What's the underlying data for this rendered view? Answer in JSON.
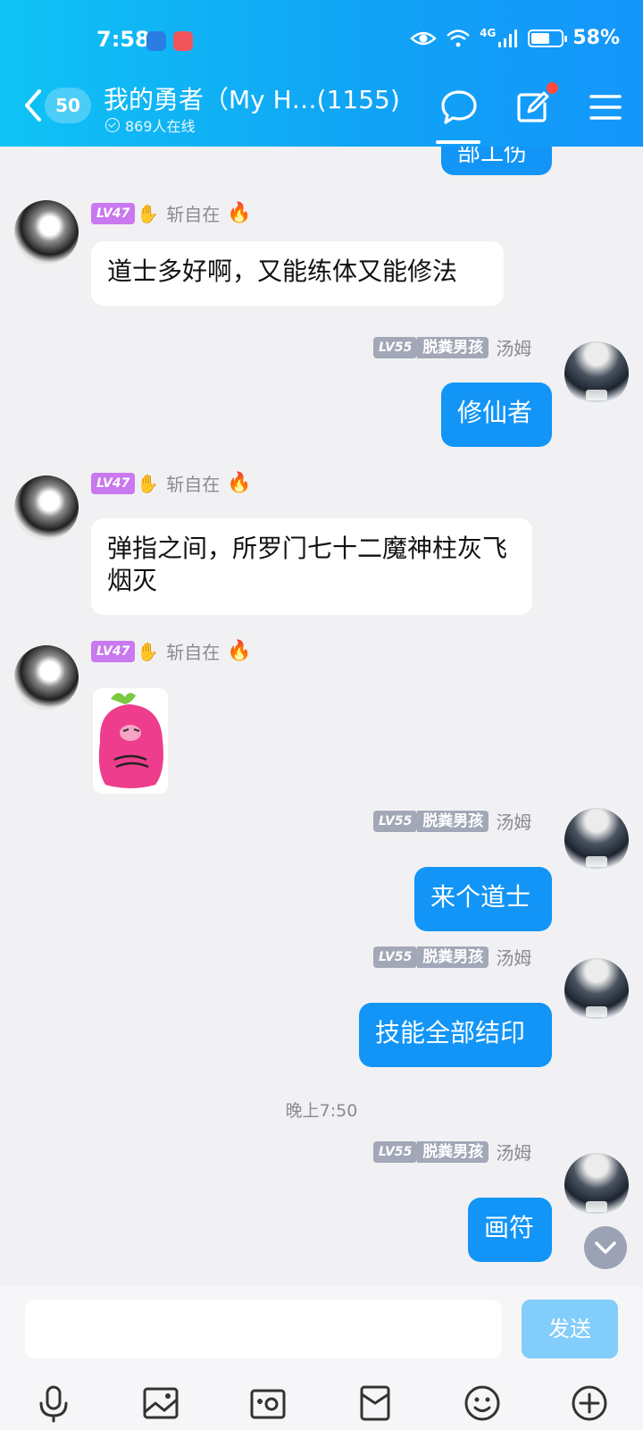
{
  "status_bar": {
    "time": "7:58",
    "network": "4G",
    "battery": "58%"
  },
  "header": {
    "unread_count": "50",
    "title": "我的勇者（My H…(1155)",
    "online": "869人在线"
  },
  "partial_bubble_text": "部工伤",
  "messages": [
    {
      "side": "left",
      "level": "LV47",
      "name": "斩自在",
      "text": "道士多好啊，又能练体又能修法"
    },
    {
      "side": "right",
      "level": "LV55",
      "tag": "脱粪男孩",
      "name": "汤姆",
      "text": "修仙者"
    },
    {
      "side": "left",
      "level": "LV47",
      "name": "斩自在",
      "text": "弹指之间，所罗门七十二魔神柱灰飞烟灭"
    },
    {
      "side": "left",
      "level": "LV47",
      "name": "斩自在",
      "text": ""
    },
    {
      "side": "right",
      "level": "LV55",
      "tag": "脱粪男孩",
      "name": "汤姆",
      "text": "来个道士"
    },
    {
      "side": "right",
      "level": "LV55",
      "tag": "脱粪男孩",
      "name": "汤姆",
      "text": "技能全部结印"
    },
    {
      "side": "right",
      "level": "LV55",
      "tag": "脱粪男孩",
      "name": "汤姆",
      "text": "画符"
    }
  ],
  "time_separator": "晚上7:50",
  "input_bar": {
    "send_label": "发送"
  },
  "icons": [
    "back-icon",
    "chat-bubble-icon",
    "compose-icon",
    "menu-icon",
    "mic-icon",
    "image-icon",
    "camera-icon",
    "red-packet-icon",
    "emoji-icon",
    "plus-icon",
    "chevron-down-icon"
  ]
}
